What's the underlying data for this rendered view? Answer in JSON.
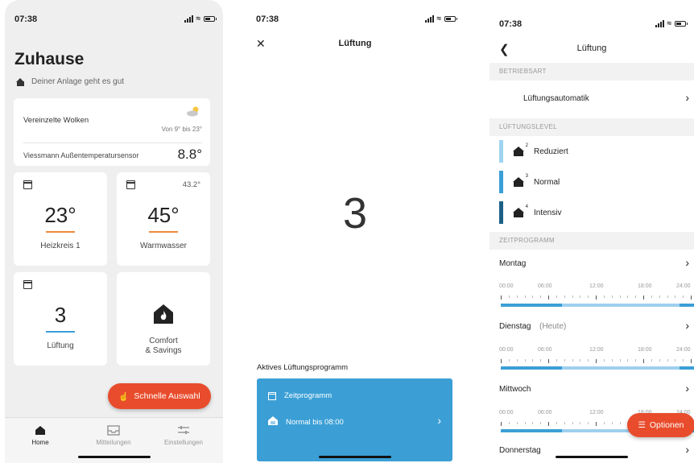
{
  "status": {
    "time": "07:38"
  },
  "home": {
    "title": "Zuhause",
    "subtitle": "Deiner Anlage geht es gut",
    "weather": {
      "title": "Vereinzelte Wolken",
      "range": "Von 9° bis 23°",
      "sensor_label": "Viessmann Außentemperatursensor",
      "sensor_value": "8.8°"
    },
    "tiles": [
      {
        "value": "23°",
        "label": "Heizkreis 1",
        "bar_color": "#f08a3c"
      },
      {
        "value": "45°",
        "label": "Warmwasser",
        "corner": "43.2°",
        "bar_color": "#f08a3c"
      },
      {
        "value": "3",
        "label": "Lüftung",
        "bar_color": "#3b9fd6"
      },
      {
        "label_line1": "Comfort",
        "label_line2": "& Savings",
        "icon": "house-flame-icon"
      }
    ],
    "fab_label": "Schnelle Auswahl",
    "nav": [
      {
        "label": "Home",
        "icon": "home-icon"
      },
      {
        "label": "Mitteilungen",
        "icon": "inbox-icon"
      },
      {
        "label": "Einstellungen",
        "icon": "sliders-icon"
      }
    ]
  },
  "ventilation_detail": {
    "title": "Lüftung",
    "level": "3",
    "section_label": "Aktives Lüftungsprogramm",
    "program": "Zeitprogramm",
    "mode": "Normal bis 08:00",
    "accent": "#3b9fd6"
  },
  "ventilation_settings": {
    "title": "Lüftung",
    "sections": {
      "mode": "BETRIEBSART",
      "level": "LÜFTUNGSLEVEL",
      "schedule": "ZEITPROGRAMM"
    },
    "mode_value": "Lüftungsautomatik",
    "levels": [
      {
        "label": "Reduziert",
        "sup": "2",
        "color": "#9fd4f0"
      },
      {
        "label": "Normal",
        "sup": "3",
        "color": "#3b9fd6"
      },
      {
        "label": "Intensiv",
        "sup": "4",
        "color": "#1e5f86"
      }
    ],
    "days": [
      {
        "name": "Montag",
        "note": ""
      },
      {
        "name": "Dienstag",
        "note": "(Heute)"
      },
      {
        "name": "Mittwoch",
        "note": ""
      },
      {
        "name": "Donnerstag",
        "note": ""
      }
    ],
    "time_labels": [
      "00:00",
      "06:00",
      "12:00",
      "18:00",
      "24:00"
    ],
    "options_label": "Optionen"
  }
}
